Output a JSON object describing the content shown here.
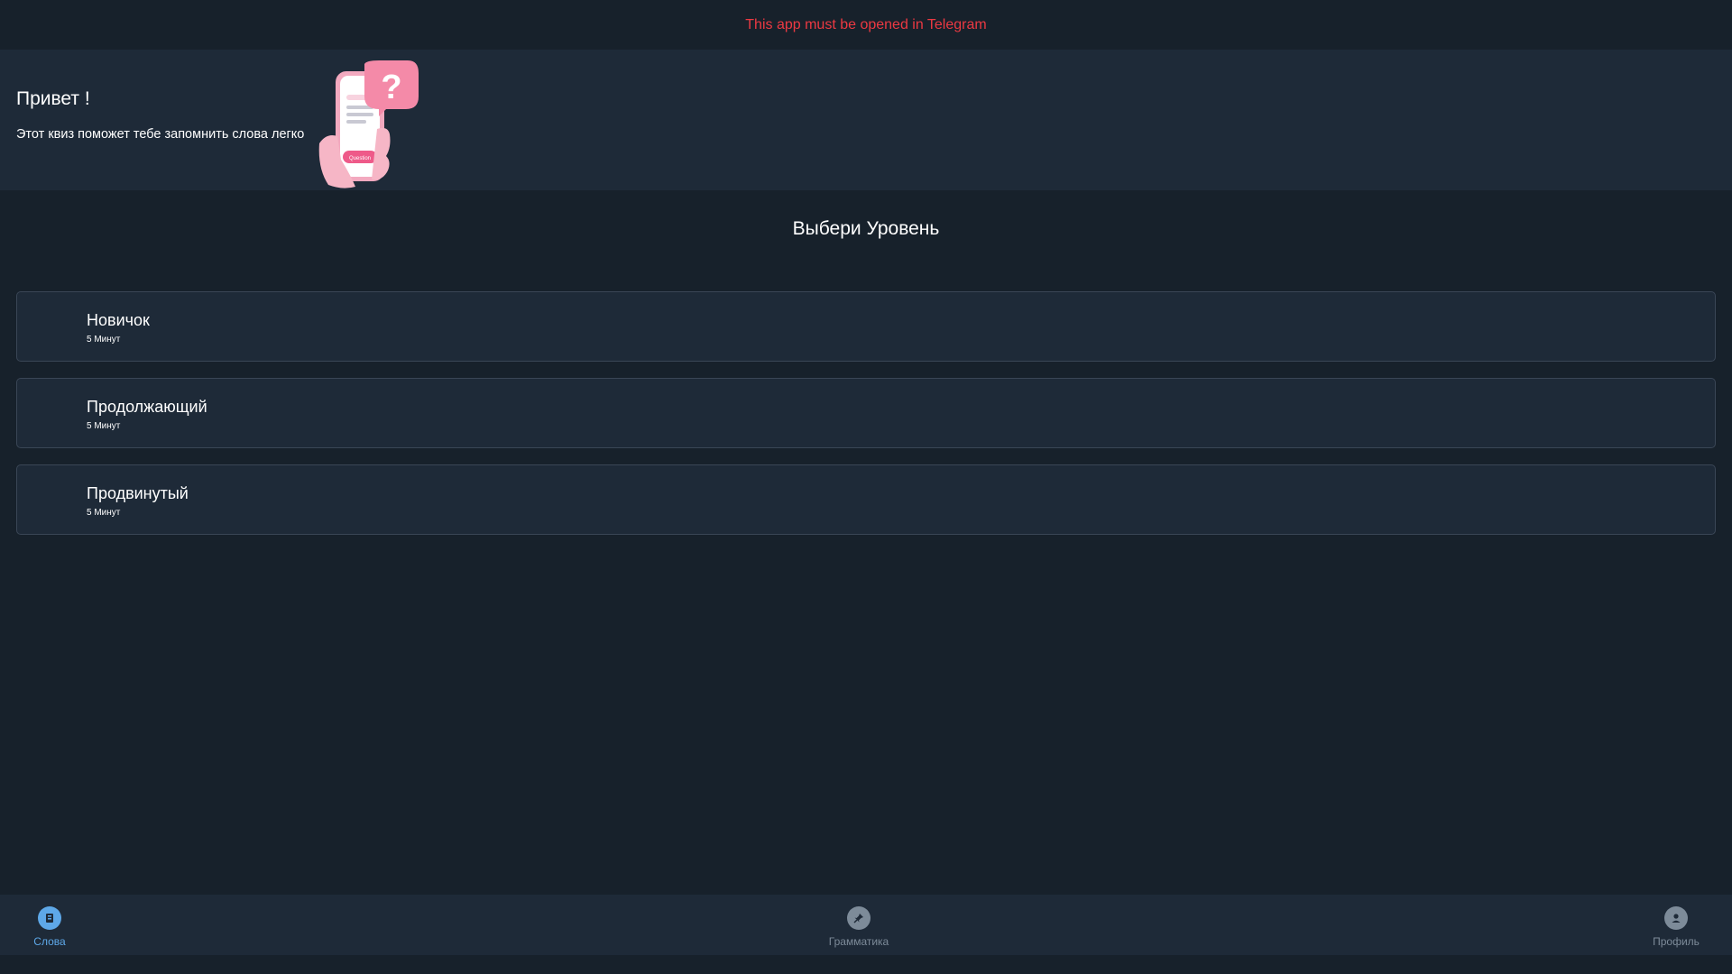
{
  "banner": {
    "text": "This app must be opened in Telegram",
    "color": "#ec3942"
  },
  "hero": {
    "title": "Привет !",
    "subtitle": "Этот квиз поможет тебе запомнить слова легко",
    "illustration": {
      "icon": "phone-question-illustration",
      "label": "Question"
    }
  },
  "section_title": "Выбери Уровень",
  "levels": [
    {
      "name": "Новичок",
      "duration": "5 Минут"
    },
    {
      "name": "Продолжающий",
      "duration": "5 Минут"
    },
    {
      "name": "Продвинутый",
      "duration": "5 Минут"
    }
  ],
  "nav": {
    "active_color": "#5ea8e8",
    "inactive_color": "#7d8b99",
    "items": [
      {
        "label": "Слова",
        "icon": "book-icon",
        "active": true
      },
      {
        "label": "Грамматика",
        "icon": "pin-icon",
        "active": false
      },
      {
        "label": "Профиль",
        "icon": "profile-icon",
        "active": false
      }
    ]
  }
}
